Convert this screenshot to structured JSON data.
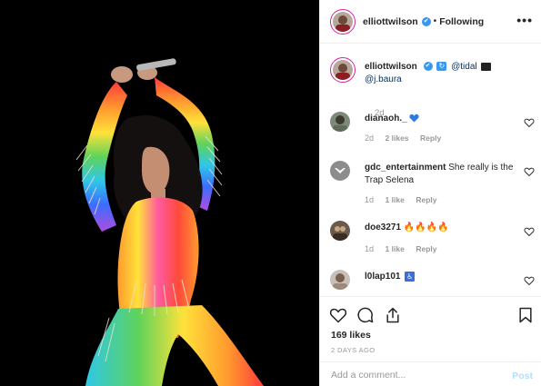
{
  "header": {
    "username": "elliottwilson",
    "verified_mark": "✔",
    "separator": "•",
    "follow_status": "Following",
    "more_label": "•••"
  },
  "caption": {
    "username": "elliottwilson",
    "tag1": "@tidal",
    "tag2": "@j.baura",
    "time": "2d"
  },
  "comments": [
    {
      "username": "dianaoh._",
      "text": "",
      "time": "2d",
      "likes": "2 likes",
      "reply": "Reply"
    },
    {
      "username": "gdc_entertainment",
      "text": "She really is the Trap Selena",
      "time": "1d",
      "likes": "1 like",
      "reply": "Reply"
    },
    {
      "username": "doe3271",
      "text": "🔥🔥🔥🔥",
      "time": "1d",
      "likes": "1 like",
      "reply": "Reply"
    },
    {
      "username": "l0lap101",
      "text": "",
      "time": "",
      "likes": "",
      "reply": ""
    }
  ],
  "actions": {
    "likes_count": "169 likes",
    "date": "2 DAYS AGO"
  },
  "add_comment": {
    "placeholder": "Add a comment...",
    "post_label": "Post"
  },
  "icons": {
    "like": "heart-icon",
    "comment": "comment-icon",
    "share": "share-icon",
    "save": "bookmark-icon",
    "more": "more-options-icon"
  },
  "colors": {
    "verified": "#3897f0",
    "story_ring": "#d6249f",
    "post_button": "#b2dffc",
    "muted_text": "#999999"
  }
}
